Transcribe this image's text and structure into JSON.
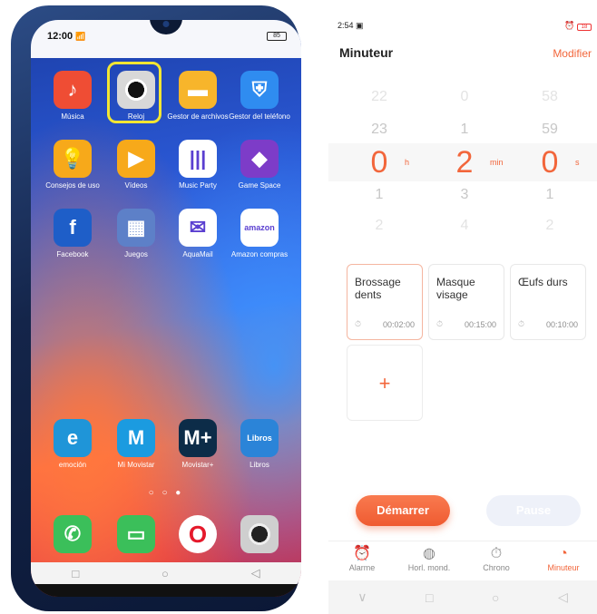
{
  "left_phone": {
    "status_time": "12:00",
    "status_signal": "📶",
    "battery": "85",
    "apps": [
      {
        "label": "Música",
        "icon": "music-icon",
        "glyph": "♪",
        "color": "#ef4d34"
      },
      {
        "label": "Reloj",
        "icon": "clock-icon",
        "glyph": "",
        "color": "#2d2d2d"
      },
      {
        "label": "Gestor de archivos",
        "icon": "folder-icon",
        "glyph": "▬",
        "color": "#f7b52b"
      },
      {
        "label": "Gestor del teléfono",
        "icon": "shield-icon",
        "glyph": "⛨",
        "color": "#2f8cf0"
      },
      {
        "label": "Consejos de uso",
        "icon": "lightbulb-icon",
        "glyph": "💡",
        "color": "#f7a91a"
      },
      {
        "label": "Vídeos",
        "icon": "play-icon",
        "glyph": "▶",
        "color": "#f7a91a"
      },
      {
        "label": "Music Party",
        "icon": "equalizer-icon",
        "glyph": "|||",
        "color": "#ffffff"
      },
      {
        "label": "Game Space",
        "icon": "cube-icon",
        "glyph": "◆",
        "color": "#7d3cc8"
      },
      {
        "label": "Facebook",
        "icon": "facebook-icon",
        "glyph": "f",
        "color": "#1e5ec8"
      },
      {
        "label": "Juegos",
        "icon": "games-folder-icon",
        "glyph": "▦",
        "color": "#5d80c8"
      },
      {
        "label": "AquaMail",
        "icon": "mail-icon",
        "glyph": "✉",
        "color": "#ffffff"
      },
      {
        "label": "Amazon compras",
        "icon": "amazon-icon",
        "glyph": "amazon",
        "color": "#ffffff"
      },
      {
        "label": "emoción",
        "icon": "emocion-icon",
        "glyph": "e",
        "color": "#1f95d8"
      },
      {
        "label": "Mi Movistar",
        "icon": "movistar-icon",
        "glyph": "M",
        "color": "#1b9be0"
      },
      {
        "label": "Movistar+",
        "icon": "movistar-plus-icon",
        "glyph": "M+",
        "color": "#0c2c48"
      },
      {
        "label": "Libros",
        "icon": "books-icon",
        "glyph": "Libros",
        "color": "#2b84d8"
      }
    ],
    "page_dots": "○ ○ ●",
    "dock": [
      {
        "icon": "phone-icon",
        "glyph": "✆",
        "color": "#3bbf5a"
      },
      {
        "icon": "messages-icon",
        "glyph": "▭",
        "color": "#3bbf5a"
      },
      {
        "icon": "opera-icon",
        "glyph": "O",
        "color": "#ffffff"
      },
      {
        "icon": "camera-icon",
        "glyph": "●",
        "color": "#3a3a3a"
      }
    ],
    "nav": {
      "square": "□",
      "circle": "○",
      "back": "◁"
    }
  },
  "right_screen": {
    "status_time": "2:54",
    "status_right_alarm": "⏰",
    "battery": "18",
    "title": "Minuteur",
    "edit": "Modifier",
    "picker": {
      "hours": {
        "above2": "22",
        "above1": "23",
        "selected": "0",
        "below1": "1",
        "below2": "2",
        "unit": "h"
      },
      "minutes": {
        "above2": "0",
        "above1": "1",
        "selected": "2",
        "below1": "3",
        "below2": "4",
        "unit": "min"
      },
      "seconds": {
        "above2": "58",
        "above1": "59",
        "selected": "0",
        "below1": "1",
        "below2": "2",
        "unit": "s"
      }
    },
    "presets": [
      {
        "name": "Brossage dents",
        "time": "00:02:00"
      },
      {
        "name": "Masque visage",
        "time": "00:15:00"
      },
      {
        "name": "Œufs durs",
        "time": "00:10:00"
      }
    ],
    "add_label": "+",
    "start_label": "Démarrer",
    "pause_label": "Pause",
    "tabs": [
      {
        "label": "Alarme",
        "icon": "alarm-icon",
        "glyph": "⏰"
      },
      {
        "label": "Horl. mond.",
        "icon": "globe-icon",
        "glyph": "◍"
      },
      {
        "label": "Chrono",
        "icon": "stopwatch-icon",
        "glyph": "⏱"
      },
      {
        "label": "Minuteur",
        "icon": "timer-icon",
        "glyph": "◔"
      }
    ],
    "nav": {
      "chevron": "∨",
      "square": "□",
      "circle": "○",
      "back": "◁"
    },
    "colors": {
      "accent": "#f2663b"
    }
  }
}
